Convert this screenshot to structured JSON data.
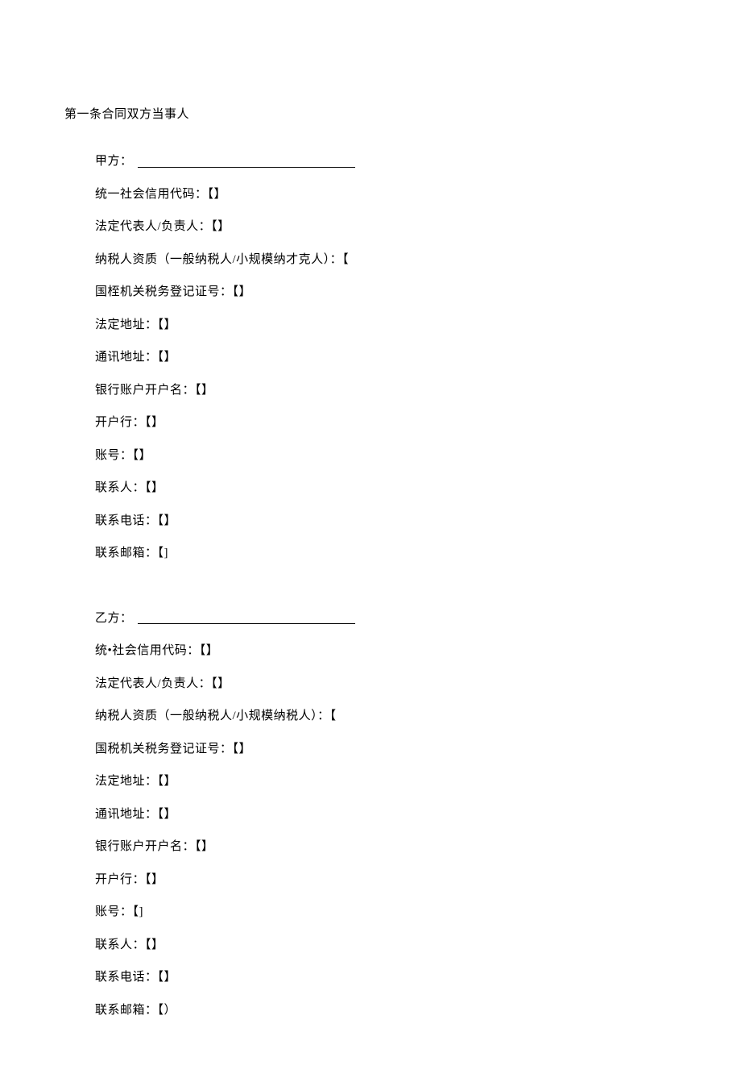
{
  "sectionTitle": "第一条合同双方当事人",
  "partyA": {
    "heading": "甲方：",
    "fields": [
      "统一社会信用代码：【】",
      "法定代表人/负责人：【】",
      "纳税人资质（一般纳税人/小规模纳才克人）：【",
      "国桎机关税务登记证号：【】",
      "法定地址：【】",
      "通讯地址：【】",
      "银行账户开户名：【】",
      "开户行：【】",
      "账号：【】",
      "联系人：【】",
      "联系电话：【】",
      "联系邮箱：【]"
    ]
  },
  "partyB": {
    "heading": "乙方：",
    "fields": [
      "统•社会信用代码：【】",
      "法定代表人/负责人：【】",
      "纳税人资质（一般纳税人/小规模纳税人）：【",
      "国税机关税务登记证号：【】",
      "法定地址：【】",
      "通讯地址：【】",
      "银行账户开户名：【】",
      "开户行：【】",
      "账号：【]",
      "联系人：【】",
      "联系电话：【】",
      "联系邮箱：【）"
    ]
  }
}
